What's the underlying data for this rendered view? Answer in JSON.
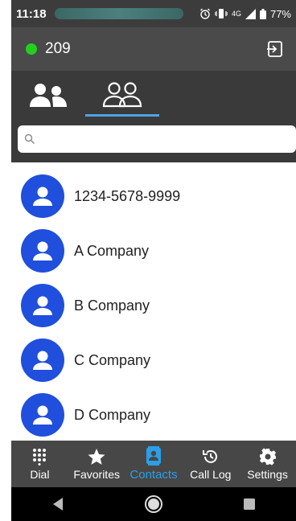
{
  "status_bar": {
    "time": "11:18",
    "network": "4G",
    "battery": "77%"
  },
  "header": {
    "extension": "209",
    "presence_color": "#22d11e"
  },
  "tabs": [
    {
      "name": "favorites-people",
      "active": false
    },
    {
      "name": "all-contacts",
      "active": true
    }
  ],
  "search": {
    "value": ""
  },
  "contacts": [
    {
      "name": "1234-5678-9999"
    },
    {
      "name": "A Company"
    },
    {
      "name": "B Company"
    },
    {
      "name": "C Company"
    },
    {
      "name": "D Company"
    }
  ],
  "bottom_nav": [
    {
      "label": "Dial",
      "icon": "dialpad-icon"
    },
    {
      "label": "Favorites",
      "icon": "star-icon"
    },
    {
      "label": "Contacts",
      "icon": "contacts-book-icon",
      "active": true
    },
    {
      "label": "Call Log",
      "icon": "history-icon"
    },
    {
      "label": "Settings",
      "icon": "gear-icon"
    }
  ],
  "colors": {
    "accent": "#2b9fe8",
    "avatar": "#1f4fdc",
    "header": "#4a4a4a"
  }
}
